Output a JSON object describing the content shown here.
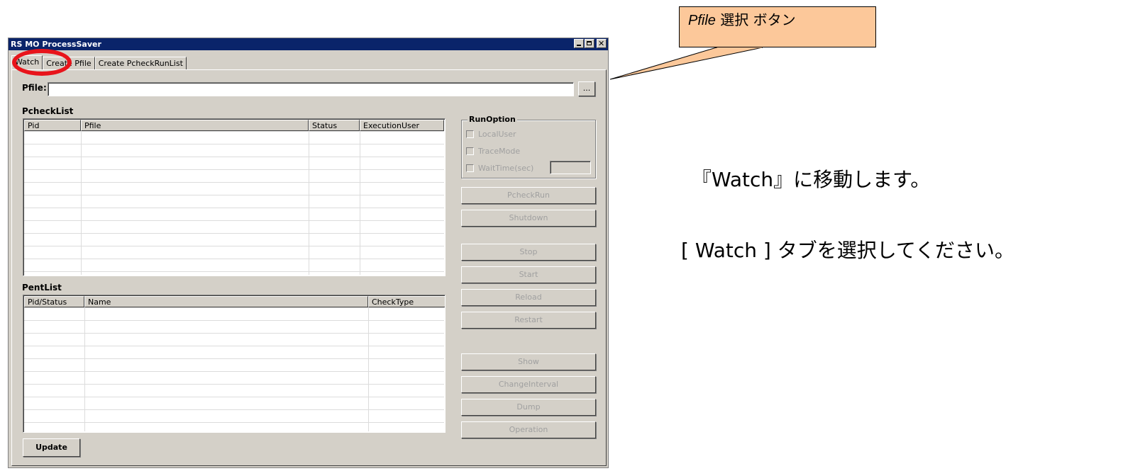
{
  "window": {
    "title": "RS MO  ProcessSaver",
    "tabs": [
      {
        "label": "Watch",
        "active": true
      },
      {
        "label": "Create Pfile",
        "active": false
      },
      {
        "label": "Create PcheckRunList",
        "active": false
      }
    ]
  },
  "pfile": {
    "label": "Pfile:",
    "value": "",
    "browse_label": "..."
  },
  "pcheck_list": {
    "label": "PcheckList",
    "columns": [
      "Pid",
      "Pfile",
      "Status",
      "ExecutionUser"
    ]
  },
  "pent_list": {
    "label": "PentList",
    "columns": [
      "Pid/Status",
      "Name",
      "CheckType"
    ]
  },
  "run_option": {
    "label": "RunOption",
    "local_user": "LocalUser",
    "trace_mode": "TraceMode",
    "wait_time": "WaitTime(sec)",
    "wait_time_value": ""
  },
  "buttons": {
    "pcheck_run": "PcheckRun",
    "shutdown": "Shutdown",
    "stop": "Stop",
    "start": "Start",
    "reload": "Reload",
    "restart": "Restart",
    "show": "Show",
    "change_interval": "ChangeInterval",
    "dump": "Dump",
    "operation": "Operation",
    "update": "Update"
  },
  "annotation": {
    "callout_italic": "Pfile",
    "callout_rest": " 選択 ボタン",
    "line1": "『Watch』に移動します。",
    "line2": "[ Watch ] タブを選択してください。"
  },
  "colors": {
    "highlight_ring": "#e8141b",
    "callout_fill": "#fcc89a",
    "titlebar": "#0a246a"
  }
}
